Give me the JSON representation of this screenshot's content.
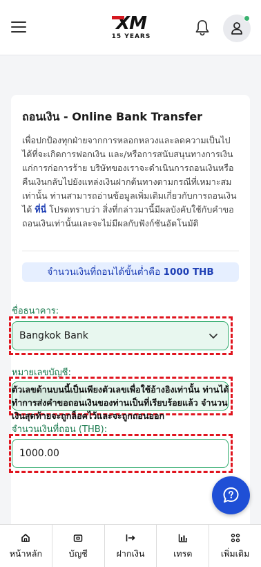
{
  "header": {
    "logo_text": "XM",
    "logo_subtitle": "15 YEARS",
    "menu_icon": "hamburger-menu-icon",
    "notification_icon": "bell-icon",
    "profile_icon": "user-icon"
  },
  "page": {
    "title": "ถอนเงิน - Online Bank Transfer",
    "description_part1": "เพื่อปกป้องทุกฝ่ายจากการหลอกหลวงและลดความเป็นไปได้ที่จะเกิดการฟอกเงิน และ/หรือการสนับสนุนทางการเงินแก่การก่อการร้าย บริษัทของเราจะดำเนินการถอนเงินหรือคืนเงินกลับไปยังแหล่งเงินฝากต้นทางตามกรณีที่เหมาะสมเท่านั้น ท่านสามารถอ่านข้อมูลเพิ่มเติมเกี่ยวกับการถอนเงินได้ ",
    "description_link": "ที่นี่",
    "description_part2": " โปรดทราบว่า สิ่งที่กล่าวมานี้มีผลบังคับใช้กับคำขอถอนเงินเท่านั้นและจะไม่มีผลกับฟังก์ชันอัตโนมัติ",
    "min_amount_prefix": "จำนวนเงินที่ถอนได้ขั้นต่ำคือ ",
    "min_amount_value": "1000 THB"
  },
  "form": {
    "bank_label": "ชื่อธนาคาร:",
    "bank_value": "Bangkok Bank",
    "account_label": "หมายเลขบัญชี:",
    "account_value": "",
    "amount_label": "จำนวนเงินที่ถอน (THB):",
    "amount_value": "1000.00",
    "note": "ตัวเลขด้านบนนี้เป็นเพียงตัวเลขเพื่อใช้อ้างอิงเท่านั้น ท่านได้ทำการส่งคำขอถอนเงินของท่านเป็นที่เรียบร้อยแล้ว จำนวนเงินสุดท้ายจะถูกล็อคไว้และจะถูกถอนออก"
  },
  "chat": {
    "icon": "chat-support-icon"
  },
  "bottom_nav": [
    {
      "label": "หน้าหลัก",
      "icon": "home-icon"
    },
    {
      "label": "บัญชี",
      "icon": "wallet-icon"
    },
    {
      "label": "ฝากเงิน",
      "icon": "deposit-arrow-icon"
    },
    {
      "label": "เทรด",
      "icon": "chart-icon"
    },
    {
      "label": "เพิ่มเติม",
      "icon": "grid-icon"
    }
  ],
  "colors": {
    "brand_red": "#d51820",
    "accent_blue": "#1e3fb5",
    "field_green": "#2eaa6b",
    "highlight_red": "#e0141e"
  }
}
